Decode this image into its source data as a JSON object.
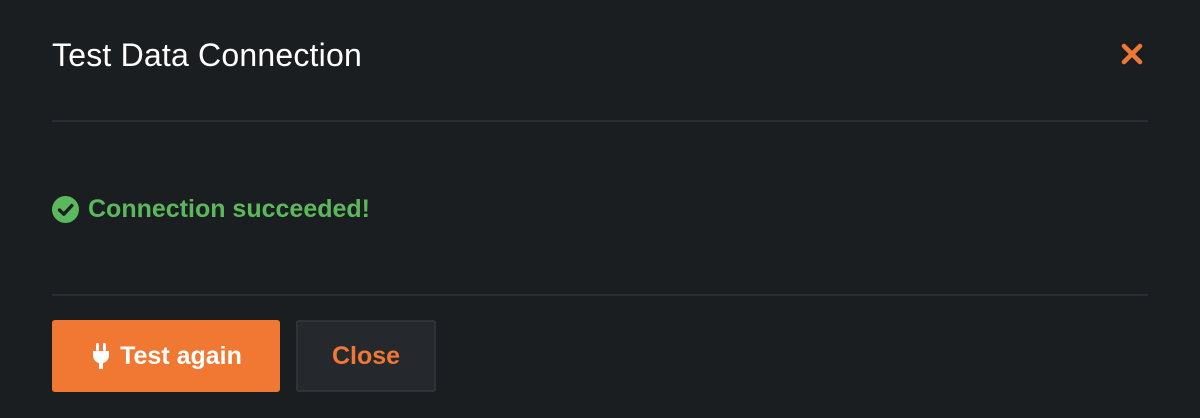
{
  "modal": {
    "title": "Test Data Connection",
    "close_icon": "close-icon"
  },
  "status": {
    "icon": "check-circle-icon",
    "message": "Connection succeeded!",
    "color": "#5cb85c"
  },
  "footer": {
    "test_again_label": "Test again",
    "test_again_icon": "plug-icon",
    "close_label": "Close"
  },
  "colors": {
    "background": "#1b1e21",
    "accent": "#f07832",
    "success": "#5cb85c",
    "divider": "#2a2e32"
  }
}
